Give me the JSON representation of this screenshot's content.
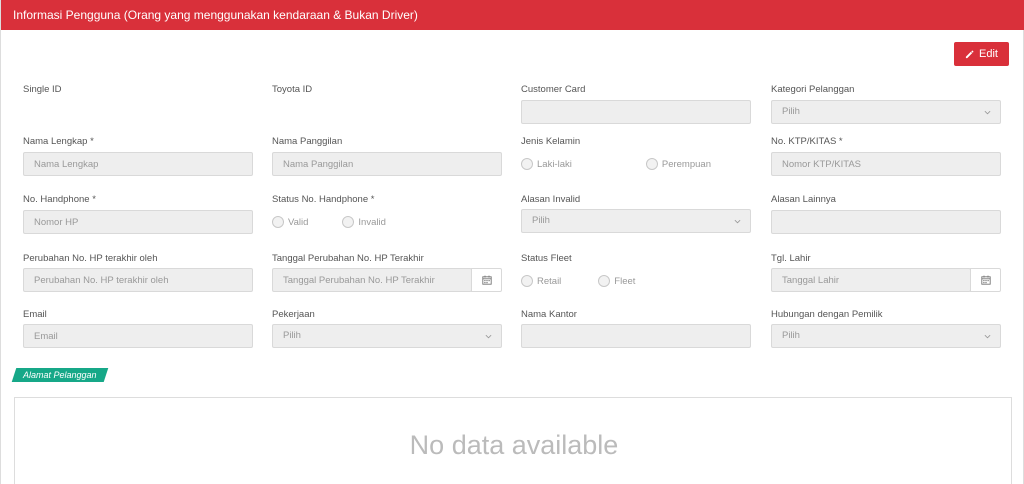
{
  "header": {
    "title": "Informasi Pengguna (Orang yang menggunakan kendaraan & Bukan Driver)"
  },
  "toolbar": {
    "edit_label": "Edit"
  },
  "fields": {
    "single_id": {
      "label": "Single ID"
    },
    "toyota_id": {
      "label": "Toyota ID"
    },
    "customer_card": {
      "label": "Customer Card",
      "value": ""
    },
    "kategori_pelanggan": {
      "label": "Kategori Pelanggan",
      "value": "Pilih"
    },
    "nama_lengkap": {
      "label": "Nama Lengkap *",
      "placeholder": "Nama Lengkap"
    },
    "nama_panggilan": {
      "label": "Nama Panggilan",
      "placeholder": "Nama Panggilan"
    },
    "jenis_kelamin": {
      "label": "Jenis Kelamin",
      "options": [
        "Laki-laki",
        "Perempuan"
      ]
    },
    "no_ktp": {
      "label": "No. KTP/KITAS *",
      "placeholder": "Nomor KTP/KITAS"
    },
    "no_handphone": {
      "label": "No. Handphone *",
      "placeholder": "Nomor HP"
    },
    "status_no_handphone": {
      "label": "Status No. Handphone *",
      "options": [
        "Valid",
        "Invalid"
      ]
    },
    "alasan_invalid": {
      "label": "Alasan Invalid",
      "value": "Pilih"
    },
    "alasan_lainnya": {
      "label": "Alasan Lainnya",
      "value": ""
    },
    "perubahan_hp_oleh": {
      "label": "Perubahan No. HP terakhir oleh",
      "placeholder": "Perubahan No. HP terakhir oleh"
    },
    "tanggal_perubahan_hp": {
      "label": "Tanggal Perubahan No. HP Terakhir",
      "placeholder": "Tanggal Perubahan No. HP Terakhir"
    },
    "status_fleet": {
      "label": "Status Fleet",
      "options": [
        "Retail",
        "Fleet"
      ]
    },
    "tgl_lahir": {
      "label": "Tgl. Lahir",
      "placeholder": "Tanggal Lahir"
    },
    "email": {
      "label": "Email",
      "placeholder": "Email"
    },
    "pekerjaan": {
      "label": "Pekerjaan",
      "value": "Pilih"
    },
    "nama_kantor": {
      "label": "Nama Kantor",
      "value": ""
    },
    "hubungan_pemilik": {
      "label": "Hubungan dengan Pemilik",
      "value": "Pilih"
    }
  },
  "address_section": {
    "tag": "Alamat Pelanggan",
    "empty_text": "No data available"
  },
  "colors": {
    "accent": "#d9303a",
    "tag": "#16a888"
  },
  "icons": {
    "edit": "pencil-icon",
    "calendar": "calendar-icon",
    "dropdown": "chevron-down-icon"
  }
}
